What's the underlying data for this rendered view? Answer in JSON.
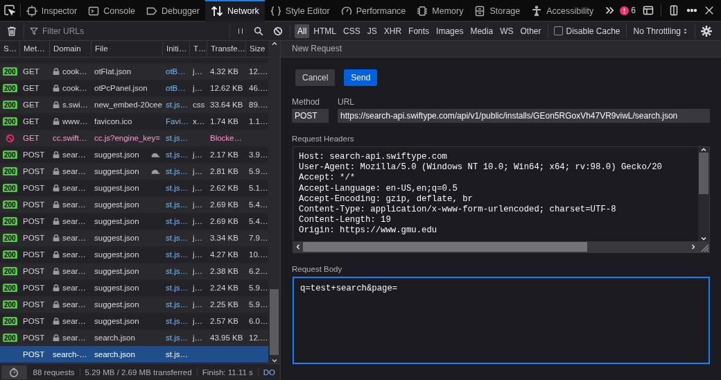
{
  "devtools_tabs": [
    {
      "label": "Inspector",
      "selected": false
    },
    {
      "label": "Console",
      "selected": false
    },
    {
      "label": "Debugger",
      "selected": false
    },
    {
      "label": "Network",
      "selected": true
    },
    {
      "label": "Style Editor",
      "selected": false
    },
    {
      "label": "Performance",
      "selected": false
    },
    {
      "label": "Memory",
      "selected": false
    },
    {
      "label": "Storage",
      "selected": false
    },
    {
      "label": "Accessibility",
      "selected": false
    }
  ],
  "error_count": "6",
  "toolbar": {
    "filter": {
      "placeholder": "Filter URLs"
    },
    "type_filters": [
      {
        "label": "All",
        "selected": true
      },
      {
        "label": "HTML",
        "selected": false
      },
      {
        "label": "CSS",
        "selected": false
      },
      {
        "label": "JS",
        "selected": false
      },
      {
        "label": "XHR",
        "selected": false
      },
      {
        "label": "Fonts",
        "selected": false
      },
      {
        "label": "Images",
        "selected": false
      },
      {
        "label": "Media",
        "selected": false
      },
      {
        "label": "WS",
        "selected": false
      },
      {
        "label": "Other",
        "selected": false
      }
    ],
    "disable_cache": {
      "label": "Disable Cache",
      "checked": false
    },
    "throttling": "No Throttling"
  },
  "table": {
    "columns": [
      "S…",
      "Met…",
      "Domain",
      "File",
      "Initi…",
      "T…",
      "Transfe…",
      "Size"
    ],
    "rows": [
      {
        "kind": "ok",
        "status": "200",
        "method": "GET",
        "secure": true,
        "domain": "cook…",
        "file": "otFlat.json",
        "slow": false,
        "initiator": "otB…",
        "type": "j…",
        "transferred": "4.32 KB",
        "size": "12.…",
        "selected": false
      },
      {
        "kind": "ok",
        "status": "200",
        "method": "GET",
        "secure": true,
        "domain": "cook…",
        "file": "otPcPanel.json",
        "slow": false,
        "initiator": "otB…",
        "type": "j…",
        "transferred": "12.62 KB",
        "size": "46.…",
        "selected": false
      },
      {
        "kind": "ok",
        "status": "200",
        "method": "GET",
        "secure": true,
        "domain": "s.swi…",
        "file": "new_embed-20cee",
        "slow": false,
        "initiator": "st.js…",
        "type": "css",
        "transferred": "33.64 KB",
        "size": "89.…",
        "selected": false
      },
      {
        "kind": "ok",
        "status": "200",
        "method": "GET",
        "secure": true,
        "domain": "www…",
        "file": "favicon.ico",
        "slow": false,
        "initiator": "Favi…",
        "type": "x…",
        "transferred": "1.74 KB",
        "size": "1.1…",
        "selected": false
      },
      {
        "kind": "blocked",
        "method": "GET",
        "secure": false,
        "domain": "cc.swift…",
        "file": "cc.js?engine_key=",
        "slow": false,
        "initiator": "st.js…",
        "transferred": "Blocke…",
        "selected": false
      },
      {
        "kind": "ok",
        "status": "200",
        "method": "POST",
        "secure": true,
        "domain": "sear…",
        "file": "suggest.json",
        "slow": true,
        "initiator": "st.js…",
        "type": "j…",
        "transferred": "2.17 KB",
        "size": "3.9…",
        "selected": false
      },
      {
        "kind": "ok",
        "status": "200",
        "method": "POST",
        "secure": true,
        "domain": "sear…",
        "file": "suggest.json",
        "slow": true,
        "initiator": "st.js…",
        "type": "j…",
        "transferred": "2.81 KB",
        "size": "5.9…",
        "selected": false
      },
      {
        "kind": "ok",
        "status": "200",
        "method": "POST",
        "secure": true,
        "domain": "sear…",
        "file": "suggest.json",
        "slow": false,
        "initiator": "st.js…",
        "type": "j…",
        "transferred": "2.62 KB",
        "size": "5.1…",
        "selected": false
      },
      {
        "kind": "ok",
        "status": "200",
        "method": "POST",
        "secure": true,
        "domain": "sear…",
        "file": "suggest.json",
        "slow": false,
        "initiator": "st.js…",
        "type": "j…",
        "transferred": "2.69 KB",
        "size": "5.4…",
        "selected": false
      },
      {
        "kind": "ok",
        "status": "200",
        "method": "POST",
        "secure": true,
        "domain": "sear…",
        "file": "suggest.json",
        "slow": false,
        "initiator": "st.js…",
        "type": "j…",
        "transferred": "2.69 KB",
        "size": "5.4…",
        "selected": false
      },
      {
        "kind": "ok",
        "status": "200",
        "method": "POST",
        "secure": true,
        "domain": "sear…",
        "file": "suggest.json",
        "slow": false,
        "initiator": "st.js…",
        "type": "j…",
        "transferred": "3.34 KB",
        "size": "7.9…",
        "selected": false
      },
      {
        "kind": "ok",
        "status": "200",
        "method": "POST",
        "secure": true,
        "domain": "sear…",
        "file": "suggest.json",
        "slow": false,
        "initiator": "st.js…",
        "type": "j…",
        "transferred": "4.27 KB",
        "size": "10.…",
        "selected": false
      },
      {
        "kind": "ok",
        "status": "200",
        "method": "POST",
        "secure": true,
        "domain": "sear…",
        "file": "suggest.json",
        "slow": false,
        "initiator": "st.js…",
        "type": "j…",
        "transferred": "2.38 KB",
        "size": "6.2…",
        "selected": false
      },
      {
        "kind": "ok",
        "status": "200",
        "method": "POST",
        "secure": true,
        "domain": "sear…",
        "file": "suggest.json",
        "slow": false,
        "initiator": "st.js…",
        "type": "j…",
        "transferred": "2.24 KB",
        "size": "5.9…",
        "selected": false
      },
      {
        "kind": "ok",
        "status": "200",
        "method": "POST",
        "secure": true,
        "domain": "sear…",
        "file": "suggest.json",
        "slow": false,
        "initiator": "st.js…",
        "type": "j…",
        "transferred": "2.25 KB",
        "size": "5.9…",
        "selected": false
      },
      {
        "kind": "ok",
        "status": "200",
        "method": "POST",
        "secure": true,
        "domain": "sear…",
        "file": "suggest.json",
        "slow": false,
        "initiator": "st.js…",
        "type": "j…",
        "transferred": "2.57 KB",
        "size": "6.0…",
        "selected": false
      },
      {
        "kind": "ok",
        "status": "200",
        "method": "POST",
        "secure": true,
        "domain": "sear…",
        "file": "search.json",
        "slow": false,
        "initiator": "st.js…",
        "type": "j…",
        "transferred": "43.95 KB",
        "size": "12.…",
        "selected": false
      },
      {
        "kind": "pending",
        "method": "POST",
        "secure": false,
        "domain": "search-…",
        "file": "search.json",
        "slow": false,
        "initiator": "st.js…",
        "selected": true
      }
    ]
  },
  "status_bar": {
    "requests": "88 requests",
    "transferred": "5.29 MB / 2.69 MB transferred",
    "finish": "Finish: 11.11 s",
    "dom": "DO"
  },
  "new_request": {
    "title": "New Request",
    "cancel": "Cancel",
    "send": "Send",
    "method_label": "Method",
    "method": "POST",
    "url_label": "URL",
    "url": "https://search-api.swiftype.com/api/v1/public/installs/GEon5RGoxVh47VR9viwL/search.json",
    "headers_label": "Request Headers",
    "headers": "Host: search-api.swiftype.com\nUser-Agent: Mozilla/5.0 (Windows NT 10.0; Win64; x64; rv:98.0) Gecko/20\nAccept: */*\nAccept-Language: en-US,en;q=0.5\nAccept-Encoding: gzip, deflate, br\nContent-Type: application/x-www-form-urlencoded; charset=UTF-8\nContent-Length: 19\nOrigin: https://www.gmu.edu",
    "body_label": "Request Body",
    "body": "q=test+search&page="
  }
}
